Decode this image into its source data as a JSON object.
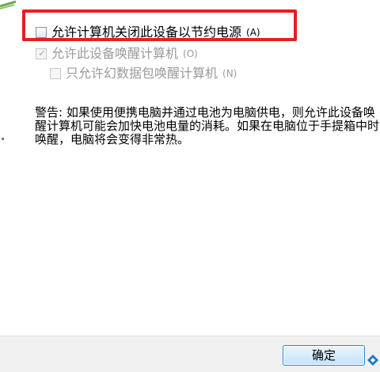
{
  "options": [
    {
      "label": "允许计算机关闭此设备以节约电源",
      "accelerator": "(A)",
      "checked": false,
      "enabled": true
    },
    {
      "label": "允许此设备唤醒计算机",
      "accelerator": "(O)",
      "checked": true,
      "enabled": false
    },
    {
      "label": "只允许幻数据包唤醒计算机",
      "accelerator": "(N)",
      "checked": false,
      "enabled": false
    }
  ],
  "warning": {
    "text": "警告: 如果使用便携电脑并通过电池为电脑供电，则允许此设备唤醒计算机可能会加快电池电量的消耗。如果在电脑位于手提箱中时唤醒，电脑将会变得非常热。"
  },
  "buttons": {
    "ok_label": "确定"
  },
  "colors": {
    "highlight": "#e32020",
    "button_border": "#2a84d4",
    "disabled_text": "#9a9a9a"
  }
}
